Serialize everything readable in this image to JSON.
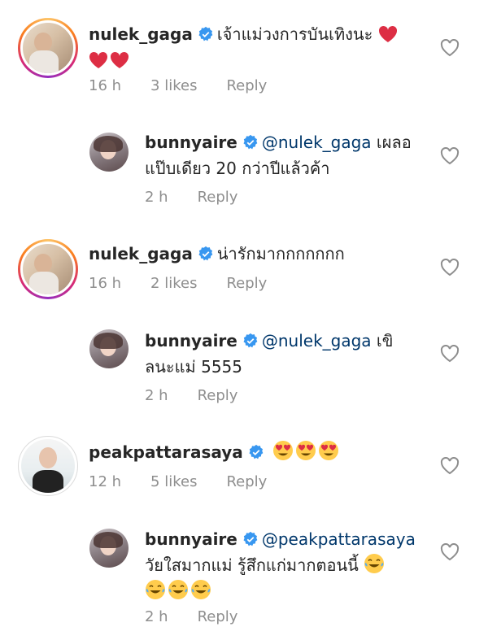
{
  "comments": [
    {
      "id": "c1",
      "user": "nulek_gaga",
      "text": "เจ้าแม่วงการบันเทิงนะ",
      "emojis_line1": "",
      "time": "16 h",
      "likes": "3 likes",
      "reply": "Reply"
    },
    {
      "id": "r1",
      "user": "bunnyaire",
      "mention": "@nulek_gaga",
      "text_line1": "เผลอ",
      "text_line2": "แป๊บเดียว 20 กว่าปีแล้วค้า",
      "time": "2 h",
      "reply": "Reply"
    },
    {
      "id": "c2",
      "user": "nulek_gaga",
      "text": "น่ารักมากกกกกกก",
      "time": "16 h",
      "likes": "2 likes",
      "reply": "Reply"
    },
    {
      "id": "r2",
      "user": "bunnyaire",
      "mention": "@nulek_gaga",
      "text_line1": "เขิ",
      "text_line2": "ลนะแม่ 5555",
      "time": "2 h",
      "reply": "Reply"
    },
    {
      "id": "c3",
      "user": "peakpattarasaya",
      "time": "12 h",
      "likes": "5 likes",
      "reply": "Reply"
    },
    {
      "id": "r3",
      "user": "bunnyaire",
      "mention": "@peakpattarasaya",
      "text_line1": "วัยใสมากแม่ รู้สึกแก่มากตอนนี้",
      "time": "2 h",
      "reply": "Reply"
    }
  ],
  "icons": {
    "verified": "verified-badge-icon",
    "like": "heart-outline-icon",
    "red_heart": "red-heart-emoji",
    "heart_eyes": "heart-eyes-emoji",
    "tears_of_joy": "tears-of-joy-emoji"
  },
  "colors": {
    "verified": "#3897f0",
    "mention": "#00376b",
    "meta": "#8e8e8e",
    "heart": "#e0245e"
  }
}
